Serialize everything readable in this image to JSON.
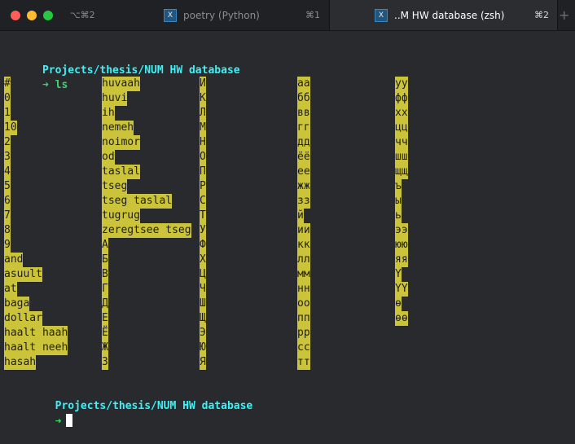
{
  "window": {
    "shortcut_left": "⌥⌘2",
    "tabs": [
      {
        "icon": "X",
        "title": "poetry (Python)",
        "shortcut": "⌘1"
      },
      {
        "icon": "X",
        "title": "..M HW database (zsh)",
        "shortcut": "⌘2"
      }
    ],
    "new_tab": "+"
  },
  "terminal": {
    "prompt_path": "Projects/thesis/NUM HW database",
    "prompt_arrow": "➜",
    "command": "ls",
    "columns": [
      [
        "#",
        "0",
        "1",
        "10",
        "2",
        "3",
        "4",
        "5",
        "6",
        "7",
        "8",
        "9",
        "and",
        "asuult",
        "at",
        "baga",
        "dollar",
        "haalt haah",
        "haalt neeh",
        "hasah"
      ],
      [
        "huvaah",
        "huvi",
        "ih",
        "nemeh",
        "noimor",
        "od",
        "taslal",
        "tseg",
        "tseg taslal",
        "tugrug",
        "zeregtsee tseg",
        "А",
        "Б",
        "В",
        "Г",
        "Д",
        "Е",
        "Ё",
        "Ж",
        "З"
      ],
      [
        "И",
        "К",
        "Л",
        "М",
        "Н",
        "О",
        "П",
        "Р",
        "С",
        "Т",
        "У",
        "Ф",
        "Х",
        "Ц",
        "Ч",
        "Ш",
        "Щ",
        "Э",
        "Ю",
        "Я"
      ],
      [
        "аа",
        "бб",
        "вв",
        "гг",
        "дд",
        "ёё",
        "ее",
        "жж",
        "зз",
        "й",
        "ии",
        "кк",
        "лл",
        "мм",
        "нн",
        "оо",
        "пп",
        "рр",
        "сс",
        "тт"
      ],
      [
        "уу",
        "фф",
        "хх",
        "цц",
        "чч",
        "шш",
        "щщ",
        "ъ",
        "ы",
        "ь",
        "ээ",
        "юю",
        "яя",
        "Ү",
        "ҮҮ",
        "ө",
        "өө"
      ]
    ],
    "prompt2_path": "Projects/thesis/NUM HW database",
    "prompt2_arrow": "➜"
  }
}
